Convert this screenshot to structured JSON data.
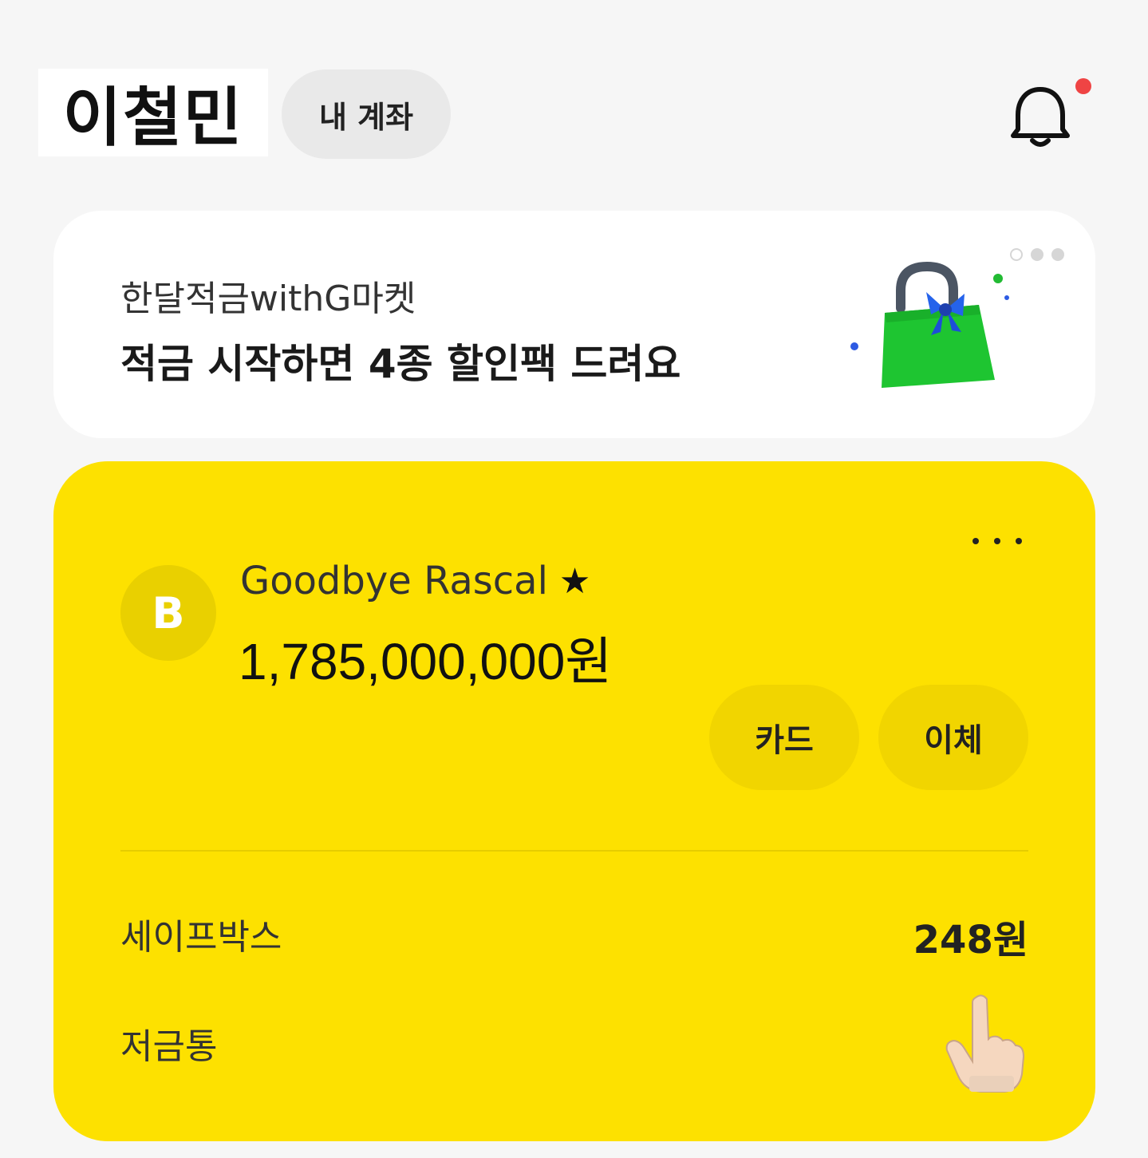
{
  "header": {
    "user_name": "이철민",
    "my_account_label": "내 계좌",
    "notification_icon": "bell-icon",
    "notification_badge_color": "#ef4444"
  },
  "promo": {
    "subtitle": "한달적금withG마켓",
    "title": "적금 시작하면 4종 할인팩 드려요",
    "illustration": "shopping-bag-icon",
    "pager_count": 3,
    "pager_active_index": 0
  },
  "account": {
    "card_color": "#fde100",
    "bank_logo_letter": "B",
    "name": "Goodbye Rascal",
    "favorite_icon": "★",
    "balance": "1,785,000,000원",
    "card_button_label": "카드",
    "transfer_button_label": "이체",
    "more_icon": "more-dots-icon",
    "rows": [
      {
        "label": "세이프박스",
        "value": "248원"
      },
      {
        "label": "저금통",
        "value": ""
      }
    ],
    "pointer_icon": "pointing-hand-icon"
  }
}
